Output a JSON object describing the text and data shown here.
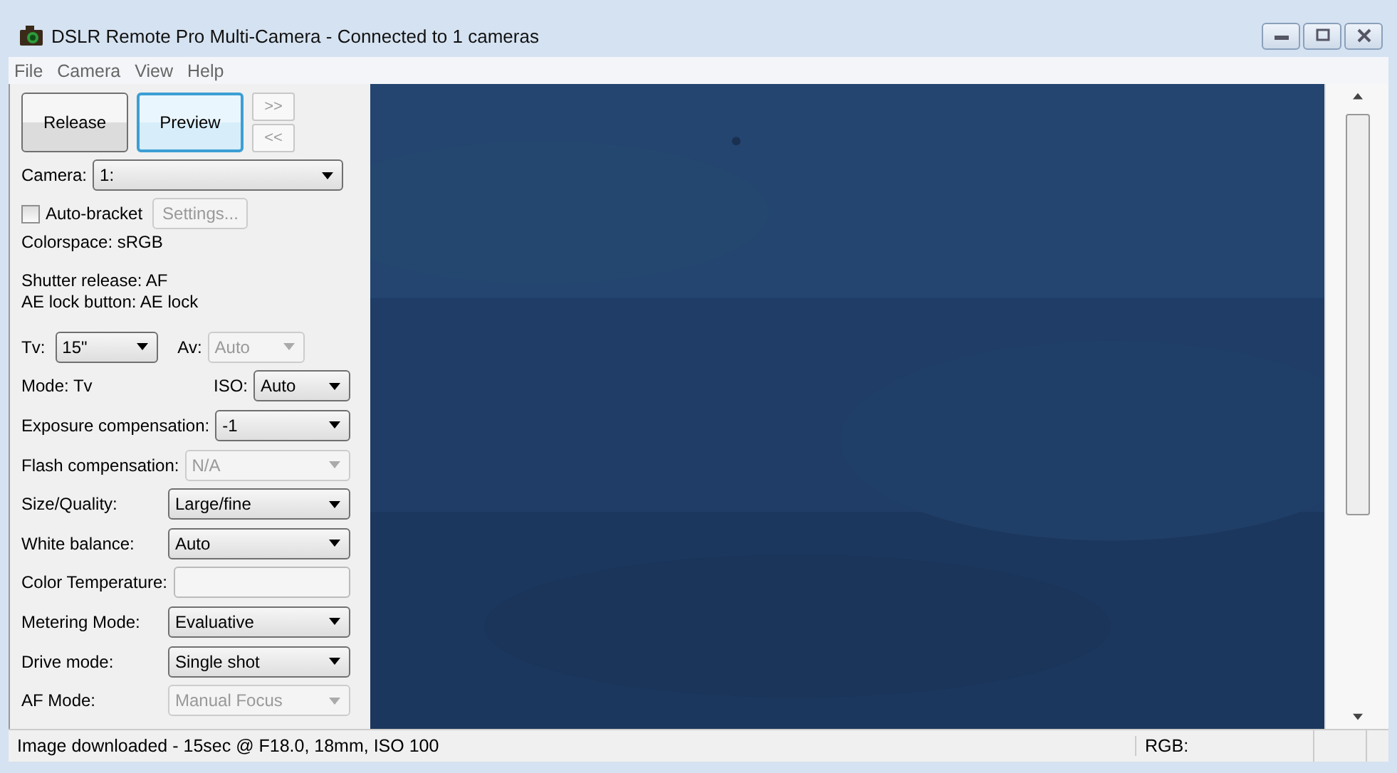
{
  "window": {
    "title": "DSLR Remote Pro Multi-Camera - Connected to 1 cameras"
  },
  "menu": [
    "File",
    "Camera",
    "View",
    "Help"
  ],
  "buttons": [
    {
      "label": "Release",
      "focused": false
    },
    {
      "label": "Preview",
      "focused": true
    }
  ],
  "nav_buttons": [
    ">>",
    "<<"
  ],
  "camera": {
    "label": "Camera:",
    "value": "1:"
  },
  "auto_bracket": {
    "label": "Auto-bracket",
    "checked": false,
    "settings": {
      "label": "Settings...",
      "disabled": true
    }
  },
  "info_lines": [
    "Colorspace: sRGB",
    "Shutter release: AF",
    "AE lock button: AE lock"
  ],
  "tv": {
    "label": "Tv:",
    "value": "15\"",
    "disabled": false
  },
  "av": {
    "label": "Av:",
    "value": "Auto",
    "disabled": true
  },
  "mode": {
    "text": "Mode: Tv"
  },
  "iso": {
    "label": "ISO:",
    "value": "Auto",
    "disabled": false
  },
  "settings": [
    {
      "kind": "dropdown",
      "label": "Exposure compensation:",
      "value": "-1",
      "disabled": false
    },
    {
      "kind": "dropdown",
      "label": "Flash compensation:",
      "value": "N/A",
      "disabled": true
    },
    {
      "kind": "dropdown",
      "label": "Size/Quality:",
      "value": "Large/fine",
      "disabled": false
    },
    {
      "kind": "dropdown",
      "label": "White balance:",
      "value": "Auto",
      "disabled": false
    },
    {
      "kind": "textbox",
      "label": "Color Temperature:"
    },
    {
      "kind": "dropdown",
      "label": "Metering Mode:",
      "value": "Evaluative",
      "disabled": false
    },
    {
      "kind": "dropdown",
      "label": "Drive mode:",
      "value": "Single shot",
      "disabled": false
    },
    {
      "kind": "dropdown",
      "label": "AF Mode:",
      "value": "Manual Focus",
      "disabled": true
    }
  ],
  "status_bar": {
    "message": "Image downloaded - 15sec @ F18.0, 18mm, ISO 100",
    "rgb": "RGB:"
  }
}
